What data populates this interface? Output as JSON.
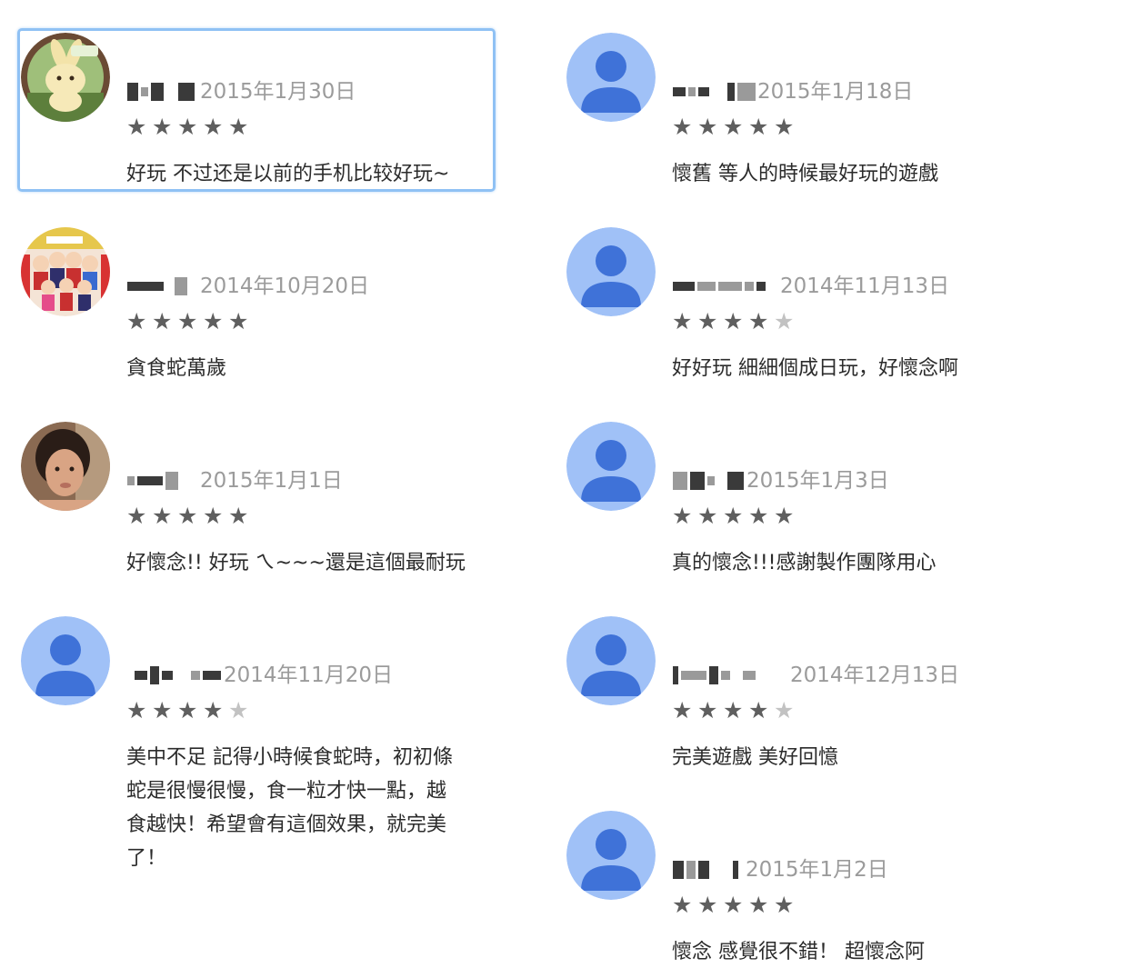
{
  "reviews": [
    {
      "date": "2015年1月30日",
      "rating": 5,
      "text": "好玩 不过还是以前的手机比较好玩~",
      "avatar": "bunny-avatar-icon",
      "focused": true
    },
    {
      "date": "2014年10月20日",
      "rating": 5,
      "text": "貪食蛇萬歲",
      "avatar": "anime-group-avatar-icon"
    },
    {
      "date": "2015年1月1日",
      "rating": 5,
      "text": "好懷念!! 好玩 ㄟ~~~還是這個最耐玩",
      "avatar": "photo-avatar-icon"
    },
    {
      "date": "2014年11月20日",
      "rating": 4,
      "text": "美中不足 記得小時候食蛇時，初初條\n蛇是很慢很慢，食一粒才快一點，越\n食越快！希望會有這個效果，就完美\n了！",
      "avatar": "default-person-icon"
    },
    {
      "date": "2015年1月18日",
      "rating": 5,
      "text": "懷舊 等人的時候最好玩的遊戲",
      "avatar": "default-person-icon"
    },
    {
      "date": "2014年11月13日",
      "rating": 4,
      "text": "好好玩 細細個成日玩，好懷念啊",
      "avatar": "default-person-icon"
    },
    {
      "date": "2015年1月3日",
      "rating": 5,
      "text": "真的懷念!!!感謝製作團隊用心",
      "avatar": "default-person-icon"
    },
    {
      "date": "2014年12月13日",
      "rating": 4,
      "text": "完美遊戲 美好回憶",
      "avatar": "default-person-icon"
    },
    {
      "date": "2015年1月2日",
      "rating": 5,
      "text": "懷念 感覺很不錯！ 超懷念阿",
      "avatar": "default-person-icon"
    }
  ],
  "colors": {
    "star_on": "#5f5f5f",
    "star_off": "#c2c2c2",
    "avatar_bg": "#a0c1f7",
    "avatar_fg": "#3f72d8",
    "focus": "#8fc1f4"
  }
}
